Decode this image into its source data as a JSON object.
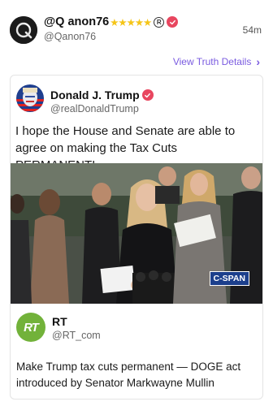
{
  "post": {
    "display_name": "@Q anon76",
    "stars": "★★★★★",
    "registered_mark": "R",
    "handle": "@Qanon76",
    "time": "54m",
    "view_link": "View Truth Details",
    "view_chevron": "›"
  },
  "quoted": {
    "display_name": "Donald J. Trump",
    "handle": "@realDonaldTrump",
    "text": "I hope the House and Senate are able to agree on making the Tax Cuts PERMANENT!",
    "media_badge": "C-SPAN"
  },
  "embedded": {
    "display_name": "RT",
    "logo_text": "RT",
    "handle": "@RT_com",
    "text": "Make Trump tax cuts permanent — DOGE act introduced by Senator Markwayne Mullin"
  },
  "colors": {
    "verified": "#e8465f",
    "link": "#7a5be0",
    "rt_green": "#72b23a",
    "stars": "#f5c518"
  }
}
